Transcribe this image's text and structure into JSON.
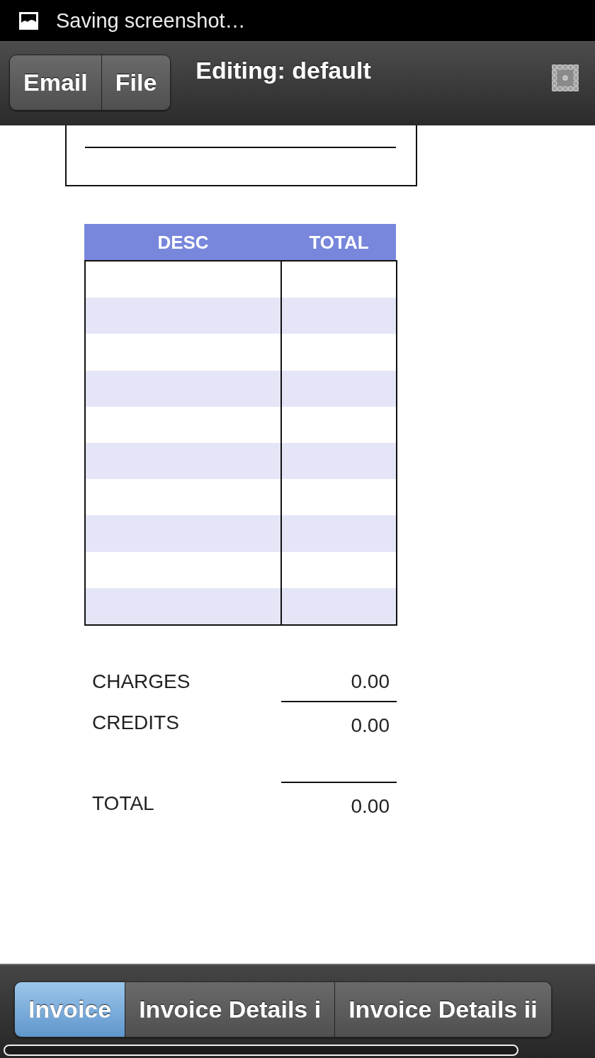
{
  "status_bar": {
    "notification": "Saving screenshot…"
  },
  "toolbar": {
    "buttons": [
      "Email",
      "File"
    ],
    "title": "Editing: default"
  },
  "invoice": {
    "table": {
      "columns": [
        "DESC",
        "TOTAL"
      ]
    },
    "summary": [
      {
        "kind": "charges",
        "label": "CHARGES",
        "value": "0.00"
      },
      {
        "kind": "credits",
        "label": "CREDITS",
        "value": "0.00"
      },
      {
        "kind": "total",
        "label": "TOTAL",
        "value": "0.00"
      }
    ]
  },
  "bottom_tabs": [
    {
      "label": "Invoice",
      "selected": true
    },
    {
      "label": "Invoice Details i",
      "selected": false
    },
    {
      "label": "Invoice Details ii",
      "selected": false
    }
  ]
}
